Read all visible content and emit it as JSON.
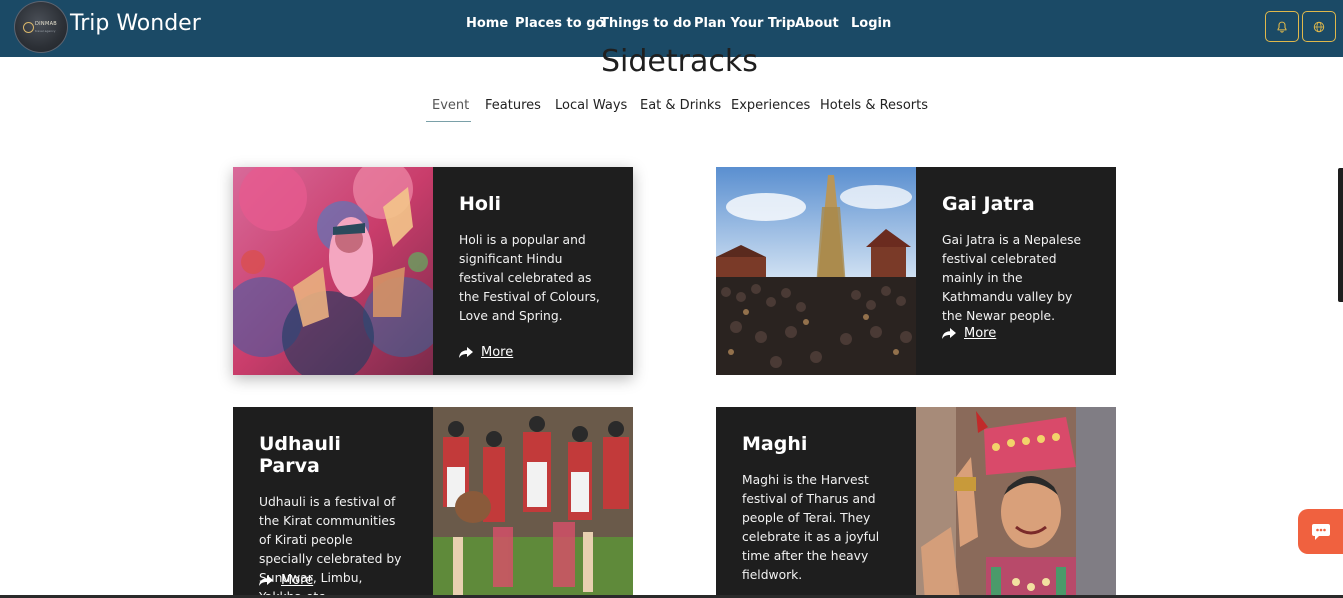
{
  "navbar": {
    "logo_text": "DINMAB",
    "logo_subtext": "travel agency",
    "brand": "Trip Wonder",
    "links": [
      "Home",
      "Places to go",
      "Things to do",
      "Plan Your Trip",
      "About",
      "Login"
    ],
    "icons": [
      "bell-icon",
      "globe-icon"
    ],
    "background": "#1b4a66",
    "button_border": "#e0b84b"
  },
  "section": {
    "title": "Sidetracks",
    "tabs": [
      "Event",
      "Features",
      "Local Ways",
      "Eat & Drinks",
      "Experiences",
      "Hotels & Resorts"
    ],
    "active_tab": "Event"
  },
  "cards": [
    {
      "title": "Holi",
      "description": "Holi is a popular and significant Hindu festival celebrated as the Festival of Colours, Love and Spring.",
      "more": "More"
    },
    {
      "title": "Gai Jatra",
      "description": "Gai Jatra is a Nepalese festival celebrated mainly in the Kathmandu valley by the Newar people.",
      "more": "More"
    },
    {
      "title": "Udhauli Parva",
      "description": "Udhauli is a festival of the Kirat communities of Kirati people specially celebrated by Sunuwar, Limbu, Yakkha etc.",
      "more": "More"
    },
    {
      "title": "Maghi",
      "description": "Maghi is the Harvest festival of Tharus and people of Terai. They celebrate it as a joyful time after the heavy fieldwork.",
      "more": "More"
    }
  ],
  "chat": {
    "icon": "chat-bubble-icon",
    "color": "#f0613f"
  }
}
